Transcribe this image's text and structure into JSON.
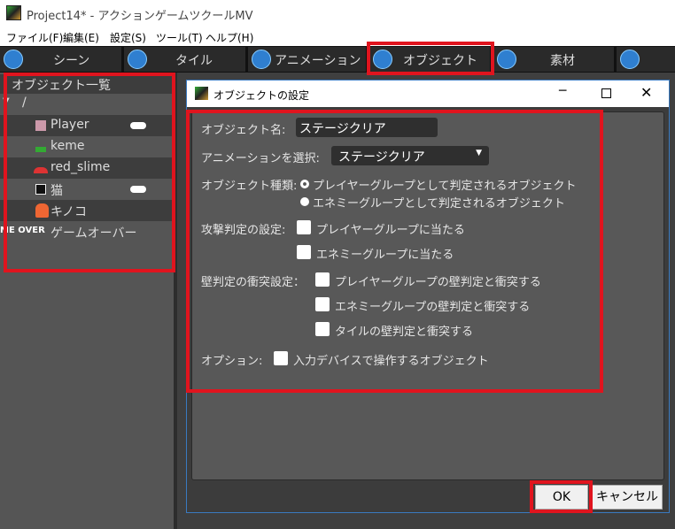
{
  "window": {
    "title": "Project14* - アクションゲームツクールMV"
  },
  "menu": [
    "ファイル(F)",
    "編集(E)",
    "設定(S)",
    "ツール(T)",
    "ヘルプ(H)"
  ],
  "tabs": [
    {
      "label": "シーン",
      "icon": "scene-icon"
    },
    {
      "label": "タイル",
      "icon": "tile-icon"
    },
    {
      "label": "アニメーション",
      "icon": "animation-icon"
    },
    {
      "label": "オブジェクト",
      "icon": "object-icon",
      "active": true
    },
    {
      "label": "素材",
      "icon": "layers-icon"
    },
    {
      "label": "",
      "icon": "tool-icon"
    }
  ],
  "object_list": {
    "title": "オブジェクト一覧",
    "root": "/",
    "items": [
      {
        "name": "Player",
        "input_device": true
      },
      {
        "name": "keme",
        "input_device": false
      },
      {
        "name": "red_slime",
        "input_device": false
      },
      {
        "name": "猫",
        "input_device": true
      },
      {
        "name": "キノコ",
        "input_device": false
      },
      {
        "name": "ゲームオーバー",
        "icon_text": "ME OVER",
        "input_device": false
      }
    ]
  },
  "dialog": {
    "title": "オブジェクトの設定",
    "name_label": "オブジェクト名:",
    "name_value": "ステージクリア",
    "anim_label": "アニメーションを選択:",
    "anim_value": "ステージクリア",
    "type_label": "オブジェクト種類:",
    "type_options": [
      "プレイヤーグループとして判定されるオブジェクト",
      "エネミーグループとして判定されるオブジェクト"
    ],
    "type_selected": 0,
    "attack_label": "攻撃判定の設定:",
    "attack_options": [
      "プレイヤーグループに当たる",
      "エネミーグループに当たる"
    ],
    "wall_label": "壁判定の衝突設定：",
    "wall_options": [
      "プレイヤーグループの壁判定と衝突する",
      "エネミーグループの壁判定と衝突する",
      "タイルの壁判定と衝突する"
    ],
    "option_label": "オプション:",
    "option_value": "入力デバイスで操作するオブジェクト",
    "ok": "OK",
    "cancel": "キャンセル"
  },
  "colors": {
    "highlight": "#e0141e"
  }
}
